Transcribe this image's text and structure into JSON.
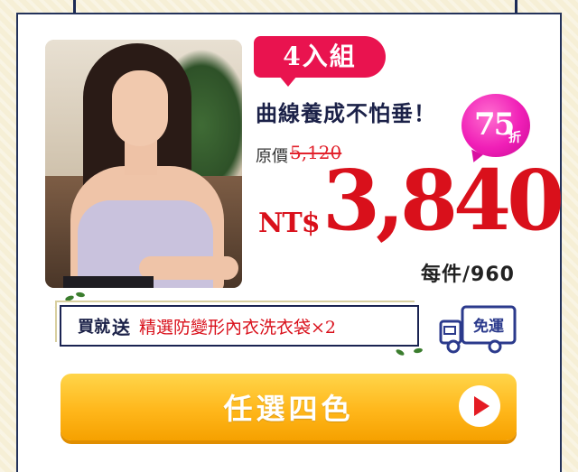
{
  "product": {
    "badge": "4入組",
    "headline": "曲線養成不怕垂！",
    "discount_num": "75",
    "discount_unit": "折",
    "original_label": "原價",
    "original_price": "5,120",
    "price_prefix": "NT$",
    "price": "3,840",
    "per_unit": "每件/960"
  },
  "gift": {
    "prefix": "買就",
    "send": "送",
    "item": "精選防變形內衣洗衣袋×2"
  },
  "shipping": {
    "label": "免運"
  },
  "cta": {
    "label": "任選四色"
  },
  "colors": {
    "accent_pink": "#e9134f",
    "price_red": "#d9101b",
    "navy": "#1b2148",
    "cta_orange": "#ffb71b"
  }
}
